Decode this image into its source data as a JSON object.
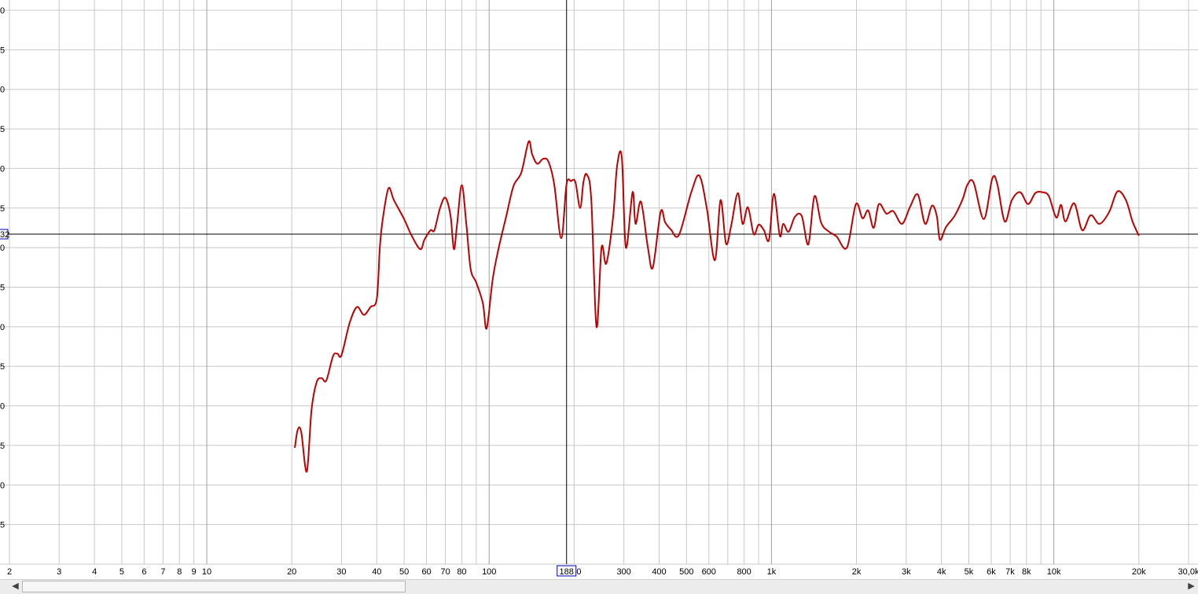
{
  "chart_data": {
    "type": "line",
    "x_scale": "log",
    "xlim": [
      2,
      30000
    ],
    "ylim": [
      -5,
      65
    ],
    "grid": true,
    "x_tick_labels": [
      {
        "v": 2,
        "t": "2"
      },
      {
        "v": 3,
        "t": "3"
      },
      {
        "v": 4,
        "t": "4"
      },
      {
        "v": 5,
        "t": "5"
      },
      {
        "v": 6,
        "t": "6"
      },
      {
        "v": 7,
        "t": "7"
      },
      {
        "v": 8,
        "t": "8"
      },
      {
        "v": 9,
        "t": "9"
      },
      {
        "v": 10,
        "t": "10"
      },
      {
        "v": 20,
        "t": "20"
      },
      {
        "v": 30,
        "t": "30"
      },
      {
        "v": 40,
        "t": "40"
      },
      {
        "v": 50,
        "t": "50"
      },
      {
        "v": 60,
        "t": "60"
      },
      {
        "v": 70,
        "t": "70"
      },
      {
        "v": 80,
        "t": "80"
      },
      {
        "v": 100,
        "t": "100"
      },
      {
        "v": 200,
        "t": "200"
      },
      {
        "v": 300,
        "t": "300"
      },
      {
        "v": 400,
        "t": "400"
      },
      {
        "v": 500,
        "t": "500"
      },
      {
        "v": 600,
        "t": "600"
      },
      {
        "v": 800,
        "t": "800"
      },
      {
        "v": 1000,
        "t": "1k"
      },
      {
        "v": 2000,
        "t": "2k"
      },
      {
        "v": 3000,
        "t": "3k"
      },
      {
        "v": 4000,
        "t": "4k"
      },
      {
        "v": 5000,
        "t": "5k"
      },
      {
        "v": 6000,
        "t": "6k"
      },
      {
        "v": 7000,
        "t": "7k"
      },
      {
        "v": 8000,
        "t": "8k"
      },
      {
        "v": 10000,
        "t": "10k"
      },
      {
        "v": 20000,
        "t": "20k"
      },
      {
        "v": 30000,
        "t": "30,0k"
      }
    ],
    "y_tick_labels": [
      {
        "v": 65,
        "t": "0"
      },
      {
        "v": 60,
        "t": "5"
      },
      {
        "v": 55,
        "t": "0"
      },
      {
        "v": 50,
        "t": "5"
      },
      {
        "v": 45,
        "t": "0"
      },
      {
        "v": 40,
        "t": "5"
      },
      {
        "v": 35,
        "t": "0"
      },
      {
        "v": 30,
        "t": "5"
      },
      {
        "v": 25,
        "t": "0"
      },
      {
        "v": 20,
        "t": "5"
      },
      {
        "v": 15,
        "t": "0"
      },
      {
        "v": 10,
        "t": "5"
      },
      {
        "v": 5,
        "t": "0"
      },
      {
        "v": 0,
        "t": "5"
      }
    ],
    "cursor": {
      "x": 188,
      "y": 36.7,
      "x_label": "188",
      "y_label": "32"
    },
    "series": [
      {
        "color": "#c00000",
        "points": [
          [
            20.5,
            9.7
          ],
          [
            21,
            12.0
          ],
          [
            21.6,
            11.7
          ],
          [
            22.6,
            6.7
          ],
          [
            23.5,
            14.5
          ],
          [
            24.5,
            18.0
          ],
          [
            25.5,
            18.5
          ],
          [
            26.5,
            18.2
          ],
          [
            28,
            21.3
          ],
          [
            29,
            21.6
          ],
          [
            30,
            21.4
          ],
          [
            32,
            25.4
          ],
          [
            34,
            27.5
          ],
          [
            36,
            26.5
          ],
          [
            38,
            27.5
          ],
          [
            40,
            28.5
          ],
          [
            41,
            35.0
          ],
          [
            42,
            38.6
          ],
          [
            44,
            42.5
          ],
          [
            46,
            41.0
          ],
          [
            50,
            38.6
          ],
          [
            53,
            36.6
          ],
          [
            57,
            34.8
          ],
          [
            59,
            36.0
          ],
          [
            62,
            37.2
          ],
          [
            64,
            37.2
          ],
          [
            67,
            40.0
          ],
          [
            70,
            41.3
          ],
          [
            73,
            39.0
          ],
          [
            75,
            34.8
          ],
          [
            77,
            38.0
          ],
          [
            80,
            42.9
          ],
          [
            83,
            38.0
          ],
          [
            86,
            32.3
          ],
          [
            90,
            30.6
          ],
          [
            95,
            28.0
          ],
          [
            98,
            24.8
          ],
          [
            103,
            31.1
          ],
          [
            108,
            34.9
          ],
          [
            115,
            39.0
          ],
          [
            122,
            42.8
          ],
          [
            130,
            44.5
          ],
          [
            138,
            48.4
          ],
          [
            142,
            46.8
          ],
          [
            148,
            45.6
          ],
          [
            155,
            46.2
          ],
          [
            162,
            45.9
          ],
          [
            170,
            43.0
          ],
          [
            180,
            36.2
          ],
          [
            188,
            43.0
          ],
          [
            195,
            43.4
          ],
          [
            202,
            43.3
          ],
          [
            210,
            40.0
          ],
          [
            216,
            43.4
          ],
          [
            222,
            44.2
          ],
          [
            230,
            41.0
          ],
          [
            240,
            25.0
          ],
          [
            250,
            35.0
          ],
          [
            260,
            33.0
          ],
          [
            275,
            39.0
          ],
          [
            284,
            45.4
          ],
          [
            295,
            46.4
          ],
          [
            305,
            35.0
          ],
          [
            322,
            42.0
          ],
          [
            330,
            38.0
          ],
          [
            345,
            40.8
          ],
          [
            365,
            35.0
          ],
          [
            380,
            32.5
          ],
          [
            405,
            39.5
          ],
          [
            420,
            38.2
          ],
          [
            440,
            37.3
          ],
          [
            470,
            36.6
          ],
          [
            520,
            42.0
          ],
          [
            555,
            44.1
          ],
          [
            590,
            40.0
          ],
          [
            630,
            33.4
          ],
          [
            660,
            41.0
          ],
          [
            690,
            35.5
          ],
          [
            720,
            37.8
          ],
          [
            760,
            41.9
          ],
          [
            790,
            38.0
          ],
          [
            825,
            40.1
          ],
          [
            865,
            36.7
          ],
          [
            900,
            37.9
          ],
          [
            940,
            37.2
          ],
          [
            980,
            36.0
          ],
          [
            1020,
            41.8
          ],
          [
            1070,
            36.5
          ],
          [
            1100,
            38.0
          ],
          [
            1150,
            37.0
          ],
          [
            1210,
            38.9
          ],
          [
            1280,
            39.0
          ],
          [
            1350,
            35.4
          ],
          [
            1420,
            41.5
          ],
          [
            1500,
            38.1
          ],
          [
            1600,
            37.0
          ],
          [
            1700,
            36.4
          ],
          [
            1850,
            35.0
          ],
          [
            1990,
            40.5
          ],
          [
            2100,
            38.7
          ],
          [
            2200,
            39.7
          ],
          [
            2300,
            37.5
          ],
          [
            2400,
            40.5
          ],
          [
            2550,
            39.3
          ],
          [
            2700,
            39.6
          ],
          [
            2900,
            38.0
          ],
          [
            3100,
            40.2
          ],
          [
            3300,
            41.7
          ],
          [
            3500,
            38.0
          ],
          [
            3700,
            40.3
          ],
          [
            3850,
            39.0
          ],
          [
            3950,
            36.0
          ],
          [
            4150,
            37.6
          ],
          [
            4450,
            39.0
          ],
          [
            4750,
            41.1
          ],
          [
            4950,
            43.0
          ],
          [
            5200,
            43.2
          ],
          [
            5650,
            38.6
          ],
          [
            6050,
            43.7
          ],
          [
            6300,
            43.1
          ],
          [
            6700,
            38.3
          ],
          [
            7100,
            41.0
          ],
          [
            7600,
            42.0
          ],
          [
            8100,
            40.5
          ],
          [
            8600,
            41.9
          ],
          [
            9100,
            42.0
          ],
          [
            9600,
            41.5
          ],
          [
            10200,
            38.8
          ],
          [
            10600,
            40.4
          ],
          [
            11000,
            38.3
          ],
          [
            11800,
            40.6
          ],
          [
            12600,
            37.2
          ],
          [
            13500,
            39.1
          ],
          [
            14500,
            38.0
          ],
          [
            15700,
            39.5
          ],
          [
            16800,
            42.1
          ],
          [
            18000,
            41.0
          ],
          [
            19000,
            38.3
          ],
          [
            20000,
            36.5
          ]
        ]
      }
    ]
  },
  "scrollbar": {
    "left_arrow": "◀",
    "right_arrow": "▶"
  }
}
